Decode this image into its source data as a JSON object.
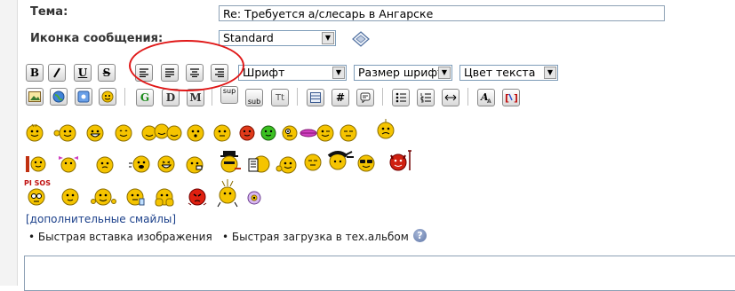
{
  "form": {
    "subject_label": "Тема:",
    "subject_value": "Re: Требуется а/слесарь в Ангарске",
    "icon_label": "Иконка сообщения:",
    "icon_value": "Standard"
  },
  "toolbar": {
    "bold": "B",
    "italic": "I",
    "underline": "U",
    "strike": "S",
    "font_value": "Шрифт",
    "size_value": "Размер шрифта",
    "color_value": "Цвет текста",
    "g_label": "G",
    "d_label": "D",
    "m_label": "M",
    "sup_label": "sup",
    "sub_label": "sub",
    "tt_label": "Tt",
    "hash_label": "#"
  },
  "links": {
    "more_smileys": "[дополнительные смайлы]",
    "quick_image": "Быстрая вставка изображения",
    "quick_upload": "Быстрая загрузка в тех.альбом",
    "help": "?"
  },
  "smileys": {
    "pisos": "PI SOS"
  },
  "colors": {
    "smiley_yellow": "#f5c400",
    "annotation_red": "#e01818",
    "link_blue": "#1a3f8a"
  }
}
